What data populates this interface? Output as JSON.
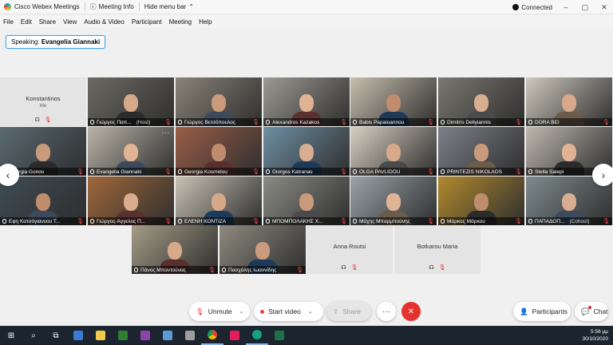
{
  "titlebar": {
    "app_title": "Cisco Webex Meetings",
    "meeting_info": "Meeting Info",
    "hide_menu": "Hide menu bar",
    "status": "Connected",
    "min": "–",
    "max": "▢",
    "close": "✕"
  },
  "menu": [
    "File",
    "Edit",
    "Share",
    "View",
    "Audio & Video",
    "Participant",
    "Meeting",
    "Help"
  ],
  "speaking": {
    "label": "Speaking:",
    "name": "Evangelia Giannaki"
  },
  "tiles": [
    {
      "name": "Konstantinos",
      "sub": "Me",
      "blank": true
    },
    {
      "name": "Γιώργος Παπ...",
      "role": "(Host)"
    },
    {
      "name": "Γιώργος Βετσόπουλος"
    },
    {
      "name": "Alexandros Kazakos"
    },
    {
      "name": "Babis Papaioannou"
    },
    {
      "name": "Dimitris Deliyiannis"
    },
    {
      "name": "DORA BEI"
    },
    {
      "name": "Georgia Gonou"
    },
    {
      "name": "Evangelia Giannaki"
    },
    {
      "name": "Georgia Kosmidou"
    },
    {
      "name": "Giorgos Katranas"
    },
    {
      "name": "OLGA PAVLIDOU"
    },
    {
      "name": "PRINTEZIS NIKOLAOS"
    },
    {
      "name": "Stella Salepi"
    },
    {
      "name": "Εφη Κατσόγιαννου Τ..."
    },
    {
      "name": "Γιώργος-Άγγελος Π..."
    },
    {
      "name": "ΕΛΕΝΗ ΚΟΝΤΙΖΑ"
    },
    {
      "name": "ΜΠΟΜΠΟΛΑΚΗΣ Χ..."
    },
    {
      "name": "Μάχης Μπαρμπούνης"
    },
    {
      "name": "Μάρκος Μάρκου"
    },
    {
      "name": "ΠΑΠΑΔΟΠ...",
      "role": "(Cohost)"
    },
    {
      "name": "Πάνος Μπαντούνας"
    },
    {
      "name": "Πασχάλης Ιωαννίδης"
    },
    {
      "name": "Anna Routsi",
      "blank": true
    },
    {
      "name": "Botkarou Maria",
      "blank": true
    }
  ],
  "controls": {
    "unmute": "Unmute",
    "start_video": "Start video",
    "share": "Share",
    "more": "···",
    "end": "✕",
    "participants": "Participants",
    "chat": "Chat"
  },
  "clock": {
    "time": "5:56 μμ",
    "date": "30/10/2020"
  },
  "colors": {
    "accent": "#27a8e8",
    "end_call": "#e4332f",
    "mute_red": "#e03030"
  }
}
